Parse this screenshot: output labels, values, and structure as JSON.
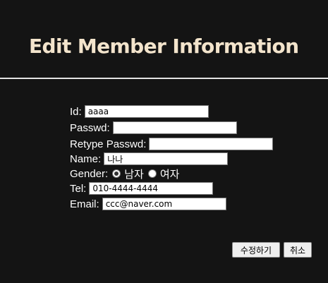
{
  "page": {
    "title": "Edit Member Information"
  },
  "form": {
    "id": {
      "label": "Id:",
      "value": "aaaa"
    },
    "passwd": {
      "label": "Passwd:",
      "value": ""
    },
    "retype": {
      "label": "Retype Passwd:",
      "value": ""
    },
    "name": {
      "label": "Name:",
      "value": "나나"
    },
    "gender": {
      "label": "Gender:",
      "options": [
        {
          "label": "남자",
          "checked": true
        },
        {
          "label": "여자",
          "checked": false
        }
      ]
    },
    "tel": {
      "label": "Tel:",
      "value": "010-4444-4444"
    },
    "email": {
      "label": "Email:",
      "value": "ccc@naver.com"
    }
  },
  "buttons": {
    "submit_label": "수정하기",
    "cancel_label": "취소"
  },
  "colors": {
    "background": "#141414",
    "title": "#f3e4cc",
    "divider": "#e3e3e3"
  }
}
